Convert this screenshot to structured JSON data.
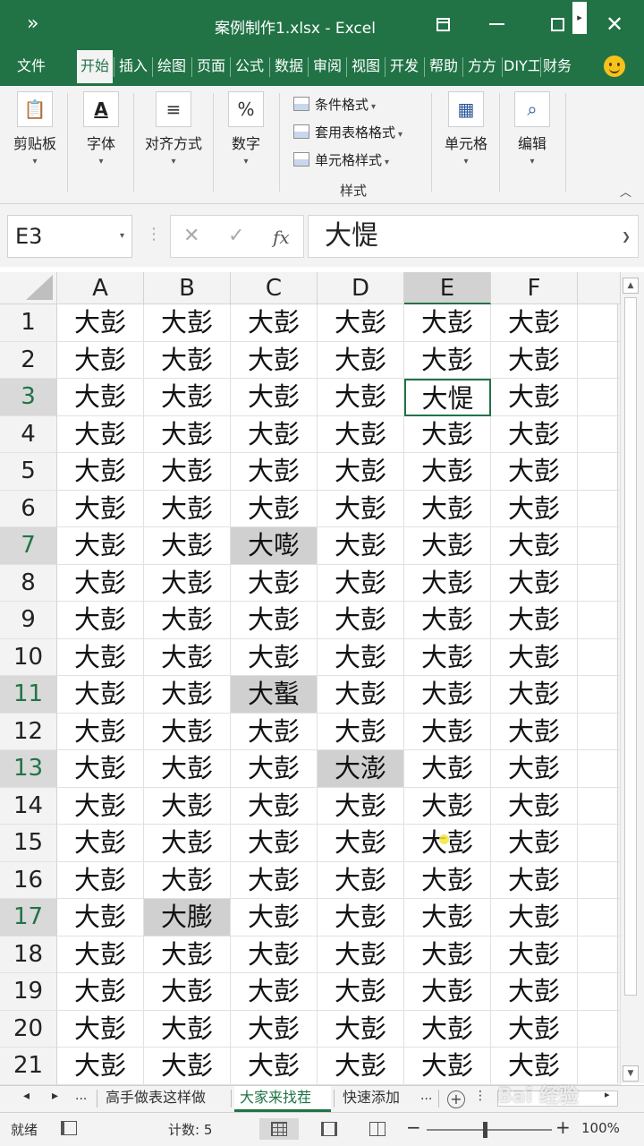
{
  "window": {
    "title": "案例制作1.xlsx  -  Excel",
    "quick_access": "»",
    "close_glyph": "✕"
  },
  "tabs": [
    {
      "label": "文件",
      "active": false
    },
    {
      "label": "开始",
      "active": true
    },
    {
      "label": "插入",
      "active": false
    },
    {
      "label": "绘图",
      "active": false
    },
    {
      "label": "页面",
      "active": false
    },
    {
      "label": "公式",
      "active": false
    },
    {
      "label": "数据",
      "active": false
    },
    {
      "label": "审阅",
      "active": false
    },
    {
      "label": "视图",
      "active": false
    },
    {
      "label": "开发",
      "active": false
    },
    {
      "label": "帮助",
      "active": false
    },
    {
      "label": "方方",
      "active": false
    },
    {
      "label": "DIY工",
      "active": false
    },
    {
      "label": "财务",
      "active": false
    }
  ],
  "ribbon": {
    "groups": [
      {
        "label": "剪贴板",
        "icon": "clipboard-icon",
        "glyph": "📋"
      },
      {
        "label": "字体",
        "icon": "font-icon",
        "glyph": "A"
      },
      {
        "label": "对齐方式",
        "icon": "align-icon",
        "glyph": "≡"
      },
      {
        "label": "数字",
        "icon": "percent-icon",
        "glyph": "%"
      },
      {
        "label": "单元格",
        "icon": "cells-icon",
        "glyph": "▦"
      },
      {
        "label": "编辑",
        "icon": "search-icon",
        "glyph": "⌕"
      }
    ],
    "styles": {
      "items": [
        "条件格式",
        "套用表格格式",
        "单元格样式"
      ],
      "group_label": "样式"
    },
    "dropdown_glyph": "▾"
  },
  "formula_bar": {
    "name_box": "E3",
    "cancel_glyph": "✕",
    "enter_glyph": "✓",
    "fx_label": "fx",
    "content": "大惿"
  },
  "grid": {
    "columns": [
      "A",
      "B",
      "C",
      "D",
      "E",
      "F"
    ],
    "selected_column": "E",
    "selected_rows": [
      3,
      7,
      11,
      13,
      17
    ],
    "default_value": "大彭",
    "rows": [
      {
        "num": "1",
        "cells": [
          "大彭",
          "大彭",
          "大彭",
          "大彭",
          "大彭",
          "大彭"
        ]
      },
      {
        "num": "2",
        "cells": [
          "大彭",
          "大彭",
          "大彭",
          "大彭",
          "大彭",
          "大彭"
        ]
      },
      {
        "num": "3",
        "cells": [
          "大彭",
          "大彭",
          "大彭",
          "大彭",
          "大惿",
          "大彭"
        ]
      },
      {
        "num": "4",
        "cells": [
          "大彭",
          "大彭",
          "大彭",
          "大彭",
          "大彭",
          "大彭"
        ]
      },
      {
        "num": "5",
        "cells": [
          "大彭",
          "大彭",
          "大彭",
          "大彭",
          "大彭",
          "大彭"
        ]
      },
      {
        "num": "6",
        "cells": [
          "大彭",
          "大彭",
          "大彭",
          "大彭",
          "大彭",
          "大彭"
        ]
      },
      {
        "num": "7",
        "cells": [
          "大彭",
          "大彭",
          "大嘭",
          "大彭",
          "大彭",
          "大彭"
        ]
      },
      {
        "num": "8",
        "cells": [
          "大彭",
          "大彭",
          "大彭",
          "大彭",
          "大彭",
          "大彭"
        ]
      },
      {
        "num": "9",
        "cells": [
          "大彭",
          "大彭",
          "大彭",
          "大彭",
          "大彭",
          "大彭"
        ]
      },
      {
        "num": "10",
        "cells": [
          "大彭",
          "大彭",
          "大彭",
          "大彭",
          "大彭",
          "大彭"
        ]
      },
      {
        "num": "11",
        "cells": [
          "大彭",
          "大彭",
          "大蟚",
          "大彭",
          "大彭",
          "大彭"
        ]
      },
      {
        "num": "12",
        "cells": [
          "大彭",
          "大彭",
          "大彭",
          "大彭",
          "大彭",
          "大彭"
        ]
      },
      {
        "num": "13",
        "cells": [
          "大彭",
          "大彭",
          "大彭",
          "大澎",
          "大彭",
          "大彭"
        ]
      },
      {
        "num": "14",
        "cells": [
          "大彭",
          "大彭",
          "大彭",
          "大彭",
          "大彭",
          "大彭"
        ]
      },
      {
        "num": "15",
        "cells": [
          "大彭",
          "大彭",
          "大彭",
          "大彭",
          "大彭",
          "大彭"
        ]
      },
      {
        "num": "16",
        "cells": [
          "大彭",
          "大彭",
          "大彭",
          "大彭",
          "大彭",
          "大彭"
        ]
      },
      {
        "num": "17",
        "cells": [
          "大彭",
          "大膨",
          "大彭",
          "大彭",
          "大彭",
          "大彭"
        ]
      },
      {
        "num": "18",
        "cells": [
          "大彭",
          "大彭",
          "大彭",
          "大彭",
          "大彭",
          "大彭"
        ]
      },
      {
        "num": "19",
        "cells": [
          "大彭",
          "大彭",
          "大彭",
          "大彭",
          "大彭",
          "大彭"
        ]
      },
      {
        "num": "20",
        "cells": [
          "大彭",
          "大彭",
          "大彭",
          "大彭",
          "大彭",
          "大彭"
        ]
      },
      {
        "num": "21",
        "cells": [
          "大彭",
          "大彭",
          "大彭",
          "大彭",
          "大彭",
          "大彭"
        ]
      }
    ],
    "highlighted": [
      [
        7,
        "C"
      ],
      [
        11,
        "C"
      ],
      [
        13,
        "D"
      ],
      [
        17,
        "B"
      ]
    ],
    "active_cell": [
      3,
      "E"
    ]
  },
  "sheets": {
    "nav_prev": "◂",
    "nav_next": "▸",
    "more": "...",
    "tabs": [
      {
        "label": "高手做表这样做",
        "active": false
      },
      {
        "label": "大家来找茬",
        "active": true
      },
      {
        "label": "快速添加",
        "active": false
      }
    ],
    "more_right": "...",
    "add_glyph": "+"
  },
  "status": {
    "ready": "就绪",
    "count": "计数: 5",
    "zoom": "100%",
    "zoom_minus": "−",
    "zoom_plus": "+"
  },
  "watermark": "Bai 经验",
  "colors": {
    "accent": "#217346",
    "highlight": "#d0d0d0"
  }
}
